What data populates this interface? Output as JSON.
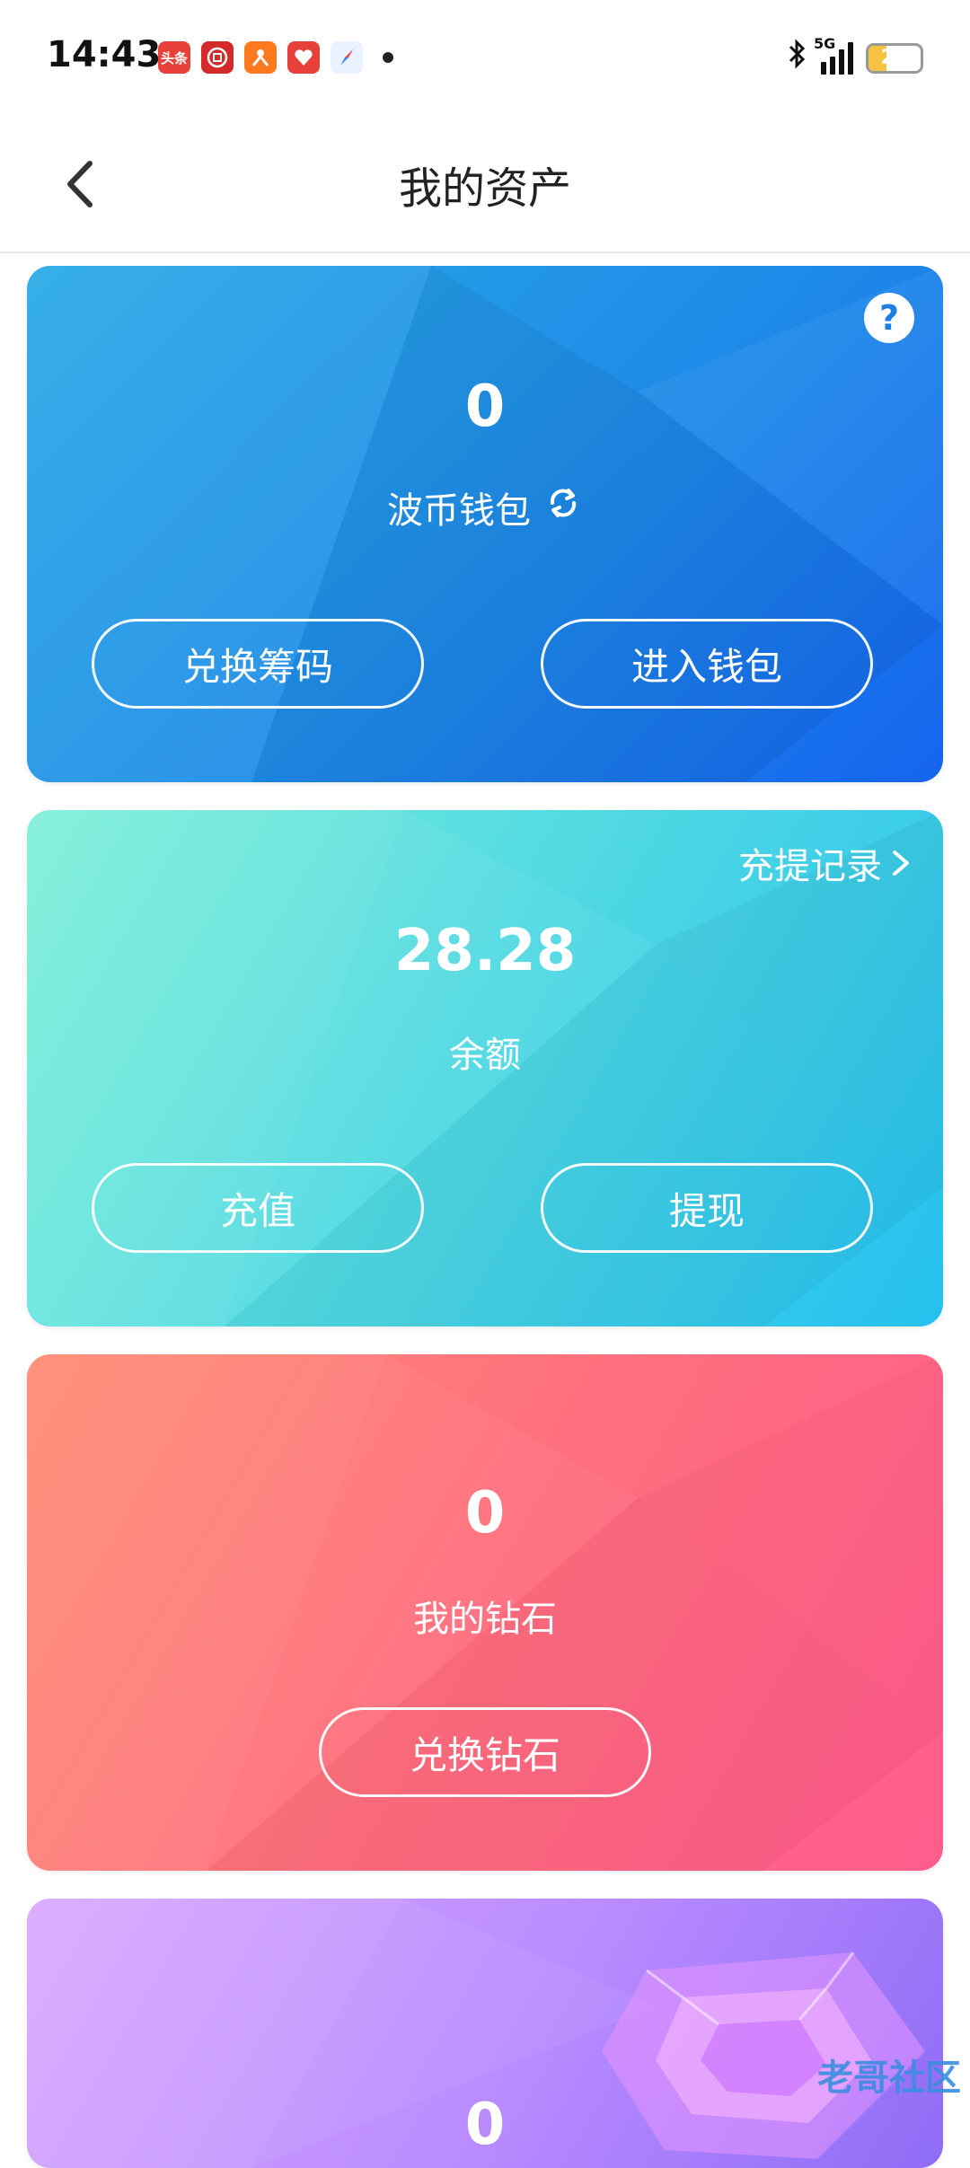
{
  "status_bar": {
    "time": "14:43",
    "app_icons": [
      {
        "name": "toutiao-icon",
        "text": "头条",
        "color": "#e8413b"
      },
      {
        "name": "bank-icon",
        "text": "",
        "color": "#d42a2a"
      },
      {
        "name": "person-app-icon",
        "text": "",
        "color": "#ff7a1e"
      },
      {
        "name": "heart-app-icon",
        "text": "",
        "color": "#e8413b"
      },
      {
        "name": "compass-icon",
        "text": "",
        "color": "#3a87f5"
      }
    ],
    "network": "5G",
    "battery": "28",
    "battery_level": 0.28
  },
  "header": {
    "title": "我的资产"
  },
  "cards": {
    "wallet": {
      "amount": "0",
      "label": "波币钱包",
      "buttons": {
        "left": "兑换筹码",
        "right": "进入钱包"
      },
      "help": "?"
    },
    "balance": {
      "amount": "28.28",
      "label": "余额",
      "record_link": "充提记录",
      "buttons": {
        "left": "充值",
        "right": "提现"
      }
    },
    "diamond": {
      "amount": "0",
      "label": "我的钻石",
      "button": "兑换钻石"
    },
    "fourth": {
      "amount": "0"
    }
  },
  "watermark": "老哥社区",
  "colors": {
    "card1": "#1e8be8",
    "card2": "#4fd8e3",
    "card3": "#ff6f7e",
    "card4": "#b98bff"
  }
}
